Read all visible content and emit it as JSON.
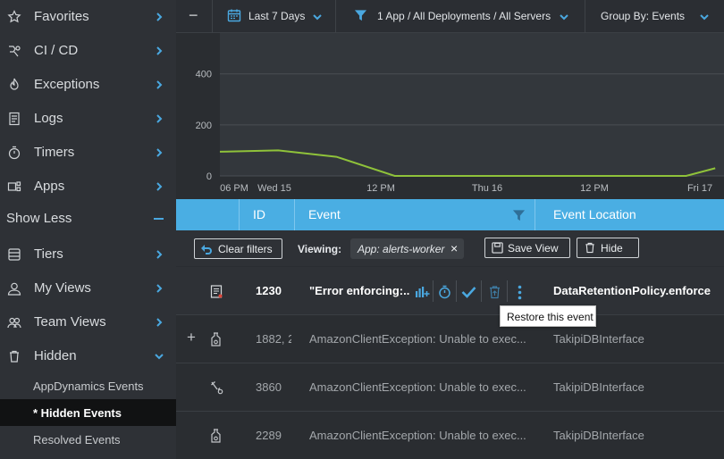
{
  "sidebar": {
    "items": [
      {
        "label": "Favorites",
        "icon": "star-icon"
      },
      {
        "label": "CI / CD",
        "icon": "cicd-icon"
      },
      {
        "label": "Exceptions",
        "icon": "flame-icon"
      },
      {
        "label": "Logs",
        "icon": "logs-icon"
      },
      {
        "label": "Timers",
        "icon": "timer-icon"
      },
      {
        "label": "Apps",
        "icon": "apps-icon"
      }
    ],
    "show_less_label": "Show Less",
    "items_more": [
      {
        "label": "Tiers",
        "icon": "tiers-icon"
      },
      {
        "label": "My Views",
        "icon": "user-icon"
      },
      {
        "label": "Team Views",
        "icon": "team-icon"
      },
      {
        "label": "Hidden",
        "icon": "trash-icon"
      }
    ],
    "hidden_sub": [
      {
        "label": "AppDynamics Events"
      },
      {
        "label": "* Hidden Events"
      },
      {
        "label": "Resolved Events"
      }
    ]
  },
  "topbar": {
    "collapse_symbol": "−",
    "date_range": "Last 7 Days",
    "filter": "1 App / All Deployments / All Servers",
    "group_by": "Group By: Events"
  },
  "chart_data": {
    "type": "line",
    "x_ticks": [
      "06 PM",
      "Wed 15",
      "12 PM",
      "Thu 16",
      "12 PM",
      "Fri 17"
    ],
    "y_ticks": [
      0,
      200,
      400
    ],
    "ylim": [
      0,
      560
    ],
    "series": [
      {
        "color": "#8fc23a",
        "x": [
          0,
          2,
          4,
          6,
          8,
          10,
          12,
          14,
          16,
          17
        ],
        "values": [
          95,
          100,
          75,
          0,
          0,
          0,
          0,
          0,
          0,
          30
        ]
      }
    ]
  },
  "table": {
    "headers": {
      "id": "ID",
      "event": "Event",
      "location": "Event Location"
    },
    "rows": [
      {
        "id": "1230",
        "event": "\"Error enforcing:...",
        "location": "DataRetentionPolicy.enforce",
        "icon": "log-doc-icon"
      },
      {
        "id": "1882, 2",
        "event": "AmazonClientException: Unable to exec...",
        "location": "TakipiDBInterface",
        "icon": "bottle-icon"
      },
      {
        "id": "3860",
        "event": "AmazonClientException: Unable to exec...",
        "location": "TakipiDBInterface",
        "icon": "wrench-icon"
      },
      {
        "id": "2289",
        "event": "AmazonClientException: Unable to exec...",
        "location": "TakipiDBInterface",
        "icon": "bottle-icon"
      }
    ],
    "expand_symbol": "+"
  },
  "filterbar": {
    "clear_label": "Clear filters",
    "viewing_label": "Viewing:",
    "chip_label": "App: alerts-worker",
    "chip_close": "×",
    "save_view_label": "Save View",
    "hide_label": "Hide"
  },
  "tooltip": {
    "text": "Restore this event"
  },
  "colors": {
    "accent": "#4aaee3",
    "line": "#8fc23a",
    "sidebar_bg": "#2e3136",
    "main_bg": "#2a2d31"
  }
}
